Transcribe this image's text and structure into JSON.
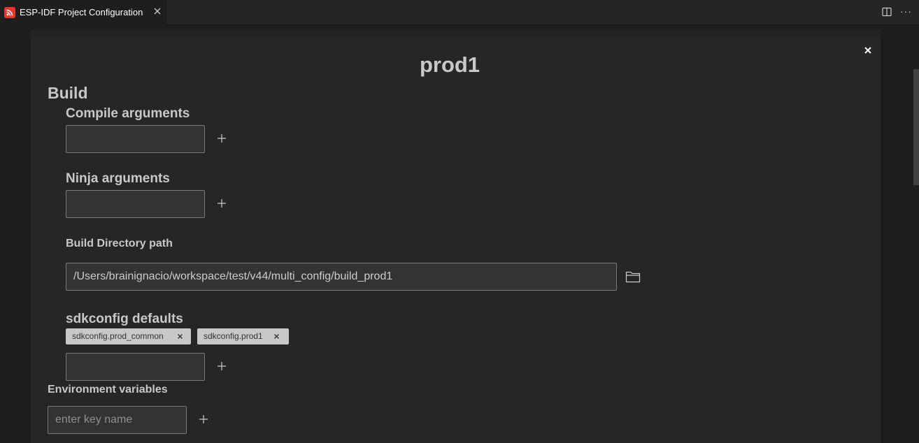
{
  "tab": {
    "title": "ESP-IDF Project Configuration"
  },
  "panel": {
    "title": "prod1",
    "build_heading": "Build",
    "compile_args": {
      "label": "Compile arguments",
      "value": ""
    },
    "ninja_args": {
      "label": "Ninja arguments",
      "value": ""
    },
    "build_dir": {
      "label": "Build Directory path",
      "value": "/Users/brainignacio/workspace/test/v44/multi_config/build_prod1"
    },
    "sdkconfig_defaults": {
      "label": "sdkconfig defaults",
      "chips": [
        "sdkconfig.prod_common",
        "sdkconfig.prod1"
      ],
      "value": ""
    },
    "env_vars": {
      "label": "Environment variables",
      "placeholder": "enter key name"
    }
  },
  "icons": [
    "esp-idf-logo-icon",
    "close-icon",
    "split-editor-icon",
    "more-actions-icon",
    "plus-icon",
    "folder-icon"
  ]
}
